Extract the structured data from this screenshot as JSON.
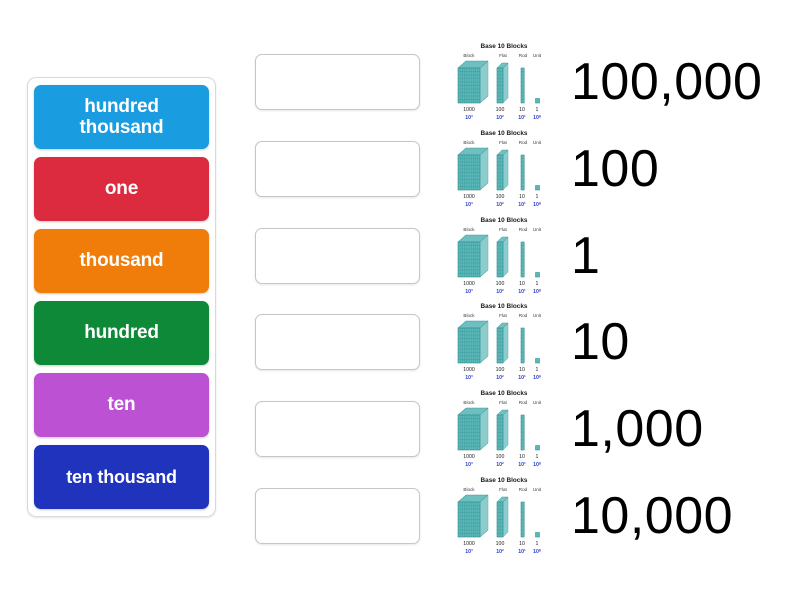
{
  "activity": {
    "type": "match-up-drag-and-drop"
  },
  "tray": {
    "name": "word-tile-tray",
    "tiles": [
      {
        "label": "hundred thousand",
        "color": "#199ce0",
        "two_line": true
      },
      {
        "label": "one",
        "color": "#dc2b3f",
        "two_line": false
      },
      {
        "label": "thousand",
        "color": "#f07c0a",
        "two_line": false
      },
      {
        "label": "hundred",
        "color": "#0e8938",
        "two_line": false
      },
      {
        "label": "ten",
        "color": "#bd51d4",
        "two_line": false
      },
      {
        "label": "ten thousand",
        "color": "#1f33bd",
        "two_line": false
      }
    ]
  },
  "drop_zones": [
    {
      "index": 1,
      "value": "",
      "placeholder": ""
    },
    {
      "index": 2,
      "value": "",
      "placeholder": ""
    },
    {
      "index": 3,
      "value": "",
      "placeholder": ""
    },
    {
      "index": 4,
      "value": "",
      "placeholder": ""
    },
    {
      "index": 5,
      "value": "",
      "placeholder": ""
    },
    {
      "index": 6,
      "value": "",
      "placeholder": ""
    }
  ],
  "answer_rows": [
    {
      "numeral": "100,000"
    },
    {
      "numeral": "100"
    },
    {
      "numeral": "1"
    },
    {
      "numeral": "10"
    },
    {
      "numeral": "1,000"
    },
    {
      "numeral": "10,000"
    }
  ],
  "base10_figure": {
    "title": "Base 10 Blocks",
    "column_headers": [
      "Block",
      "Flat",
      "Rod",
      "Unit"
    ],
    "value_labels": [
      "1000",
      "100",
      "10",
      "1"
    ],
    "power_labels": [
      "10³",
      "10²",
      "10¹",
      "10⁰"
    ],
    "block_color": "#5bb8b8",
    "block_edge_color": "#2f8a8a",
    "title_color": "#1a1a1a",
    "header_color": "#3a3a3a",
    "value_color": "#1a1a1a",
    "power_color": "#2a3fcf"
  },
  "colors": {
    "page_background": "#ffffff",
    "tray_border": "#d9d9d9",
    "dropzone_border": "#c6c6c6",
    "numeral_color": "#000000"
  }
}
